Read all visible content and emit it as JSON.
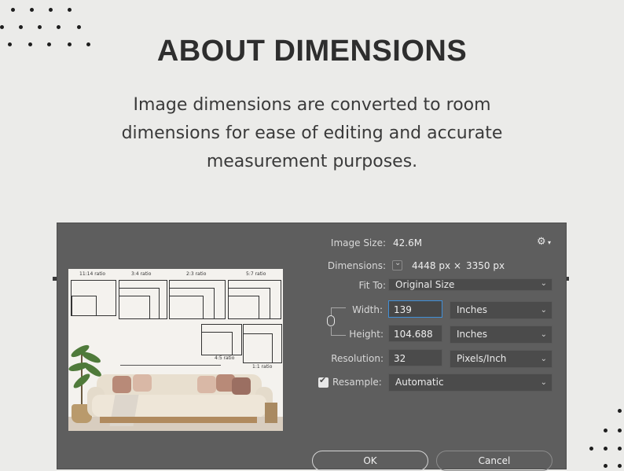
{
  "heading": "ABOUT DIMENSIONS",
  "subtitle": {
    "line1": "Image dimensions are converted to room",
    "line2": "dimensions for ease of editing and accurate",
    "line3": "measurement purposes."
  },
  "dialog": {
    "image_size": {
      "label": "Image Size:",
      "value": "42.6M"
    },
    "dimensions": {
      "label": "Dimensions:",
      "width": "4448 px",
      "times": "×",
      "height": "3350 px"
    },
    "fit_to": {
      "label": "Fit To:",
      "value": "Original Size"
    },
    "width": {
      "label": "Width:",
      "value": "139",
      "unit": "Inches"
    },
    "height": {
      "label": "Height:",
      "value": "104.688",
      "unit": "Inches"
    },
    "resolution": {
      "label": "Resolution:",
      "value": "32",
      "unit": "Pixels/Inch"
    },
    "resample": {
      "label": "Resample:",
      "value": "Automatic",
      "checked": true
    },
    "ok_label": "OK",
    "cancel_label": "Cancel",
    "icons": {
      "settings": "gear-icon",
      "chevron": "chevron-down-icon",
      "link": "chain-link-icon",
      "check": "checkmark-icon"
    }
  },
  "preview": {
    "ratios": [
      "11:14 ratio",
      "3:4 ratio",
      "2:3 ratio",
      "5:7 ratio",
      "4:5 ratio",
      "1:1 ratio"
    ]
  },
  "colors": {
    "background": "#ebebe9",
    "dialog_bg": "#5e5e5e",
    "field_bg": "#4b4b4b",
    "focus_border": "#3f8fd8"
  }
}
